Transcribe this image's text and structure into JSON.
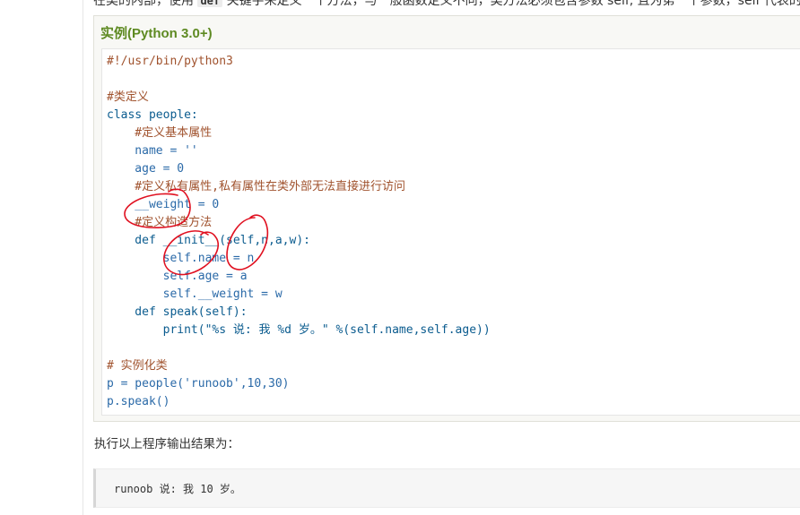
{
  "intro": {
    "text_before": "在类的内部，使用",
    "keyword": "def",
    "text_after": "关键字来定义一个方法，与一般函数定义不同，类方法必须包含参数 self, 且为第一个参数，self 代表的"
  },
  "example": {
    "title": "实例(Python 3.0+)",
    "code_lines": [
      "#!/usr/bin/python3",
      "",
      "#类定义",
      "class people:",
      "    #定义基本属性",
      "    name = ''",
      "    age = 0",
      "    #定义私有属性,私有属性在类外部无法直接进行访问",
      "    __weight = 0",
      "    #定义构造方法",
      "    def __init__(self,n,a,w):",
      "        self.name = n",
      "        self.age = a",
      "        self.__weight = w",
      "    def speak(self):",
      "        print(\"%s 说: 我 %d 岁。\" %(self.name,self.age))",
      "",
      "# 实例化类",
      "p = people('runoob',10,30)",
      "p.speak()"
    ]
  },
  "result": {
    "label": "执行以上程序输出结果为：",
    "output": "runoob 说: 我 10 岁。"
  },
  "colors": {
    "title_green": "#5e8a22",
    "annotation_red": "#e01020"
  }
}
